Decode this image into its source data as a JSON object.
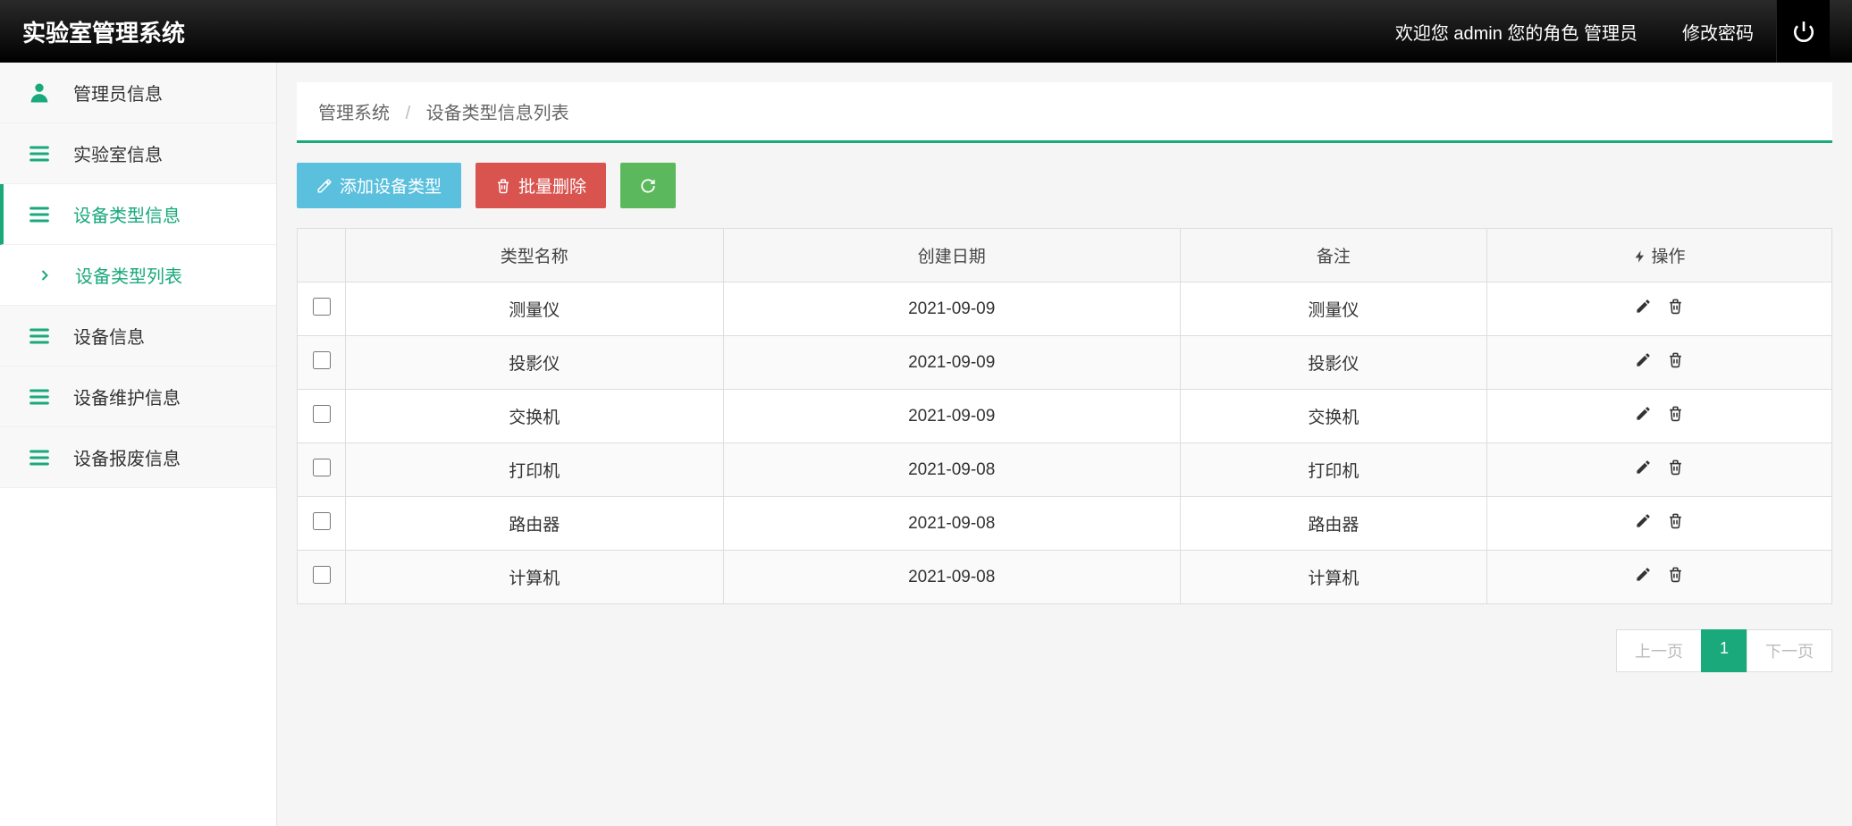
{
  "topbar": {
    "title": "实验室管理系统",
    "welcome": "欢迎您 admin 您的角色 管理员",
    "change_pwd": "修改密码"
  },
  "sidebar": {
    "items": [
      {
        "label": "管理员信息",
        "icon": "user"
      },
      {
        "label": "实验室信息",
        "icon": "bars"
      },
      {
        "label": "设备类型信息",
        "icon": "bars",
        "active": true
      },
      {
        "label": "设备类型列表",
        "icon": "chevron",
        "sub": true,
        "current": true
      },
      {
        "label": "设备信息",
        "icon": "bars"
      },
      {
        "label": "设备维护信息",
        "icon": "bars"
      },
      {
        "label": "设备报废信息",
        "icon": "bars"
      }
    ]
  },
  "crumb": {
    "root": "管理系统",
    "leaf": "设备类型信息列表"
  },
  "toolbar": {
    "add": "添加设备类型",
    "del": "批量删除"
  },
  "table": {
    "cols": [
      "类型名称",
      "创建日期",
      "备注",
      "操作"
    ],
    "rows": [
      {
        "name": "测量仪",
        "date": "2021-09-09",
        "remark": "测量仪"
      },
      {
        "name": "投影仪",
        "date": "2021-09-09",
        "remark": "投影仪"
      },
      {
        "name": "交换机",
        "date": "2021-09-09",
        "remark": "交换机"
      },
      {
        "name": "打印机",
        "date": "2021-09-08",
        "remark": "打印机"
      },
      {
        "name": "路由器",
        "date": "2021-09-08",
        "remark": "路由器"
      },
      {
        "name": "计算机",
        "date": "2021-09-08",
        "remark": "计算机"
      }
    ]
  },
  "pager": {
    "prev": "上一页",
    "page": "1",
    "next": "下一页"
  }
}
